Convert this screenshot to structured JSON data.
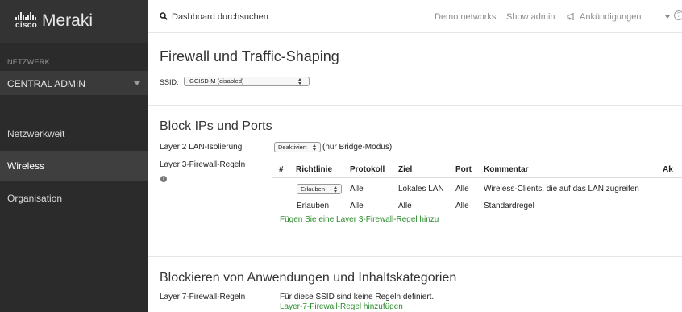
{
  "brand": {
    "cisco": "cisco",
    "product": "Meraki"
  },
  "sidebar": {
    "network_label": "NETZWERK",
    "network_name": "CENTRAL ADMIN",
    "items": [
      {
        "label": "Netzwerkweit",
        "active": false
      },
      {
        "label": "Wireless",
        "active": true
      },
      {
        "label": "Organisation",
        "active": false
      }
    ]
  },
  "topbar": {
    "search_placeholder": "Dashboard durchsuchen",
    "demo_networks": "Demo networks",
    "show_admin": "Show admin",
    "announcements": "Ankündigungen",
    "help": "?"
  },
  "page": {
    "title": "Firewall und Traffic-Shaping",
    "ssid_label": "SSID:",
    "ssid_value": "GCISD-M (disabled)"
  },
  "block_section": {
    "title": "Block IPs und Ports",
    "l2_label": "Layer 2 LAN-Isolierung",
    "l2_select": "Deaktiviert",
    "l2_note": "(nur Bridge-Modus)",
    "l3_label": "Layer 3-Firewall-Regeln",
    "info_icon": "i",
    "table": {
      "headers": [
        "#",
        "Richtlinie",
        "Protokoll",
        "Ziel",
        "Port",
        "Kommentar",
        "Ak"
      ],
      "rows": [
        {
          "policy": "Erlauben",
          "protocol": "Alle",
          "dest": "Lokales LAN",
          "port": "Alle",
          "comment": "Wireless-Clients, die auf das LAN zugreifen"
        },
        {
          "policy": "Erlauben",
          "protocol": "Alle",
          "dest": "Alle",
          "port": "Alle",
          "comment": "Standardregel"
        }
      ]
    },
    "add_rule_link": "Fügen Sie eine Layer 3-Firewall-Regel hinzu"
  },
  "app_section": {
    "title": "Blockieren von Anwendungen und Inhaltskategorien",
    "l7_label": "Layer 7-Firewall-Regeln",
    "l7_note": "Für diese SSID sind keine Regeln definiert.",
    "l7_link": "Layer-7-Firewall-Regel hinzufügen"
  },
  "colors": {
    "sidebar_bg": "#2b2b2b",
    "active_item": "#3f3f3f",
    "link_green": "#2a8a2a"
  }
}
